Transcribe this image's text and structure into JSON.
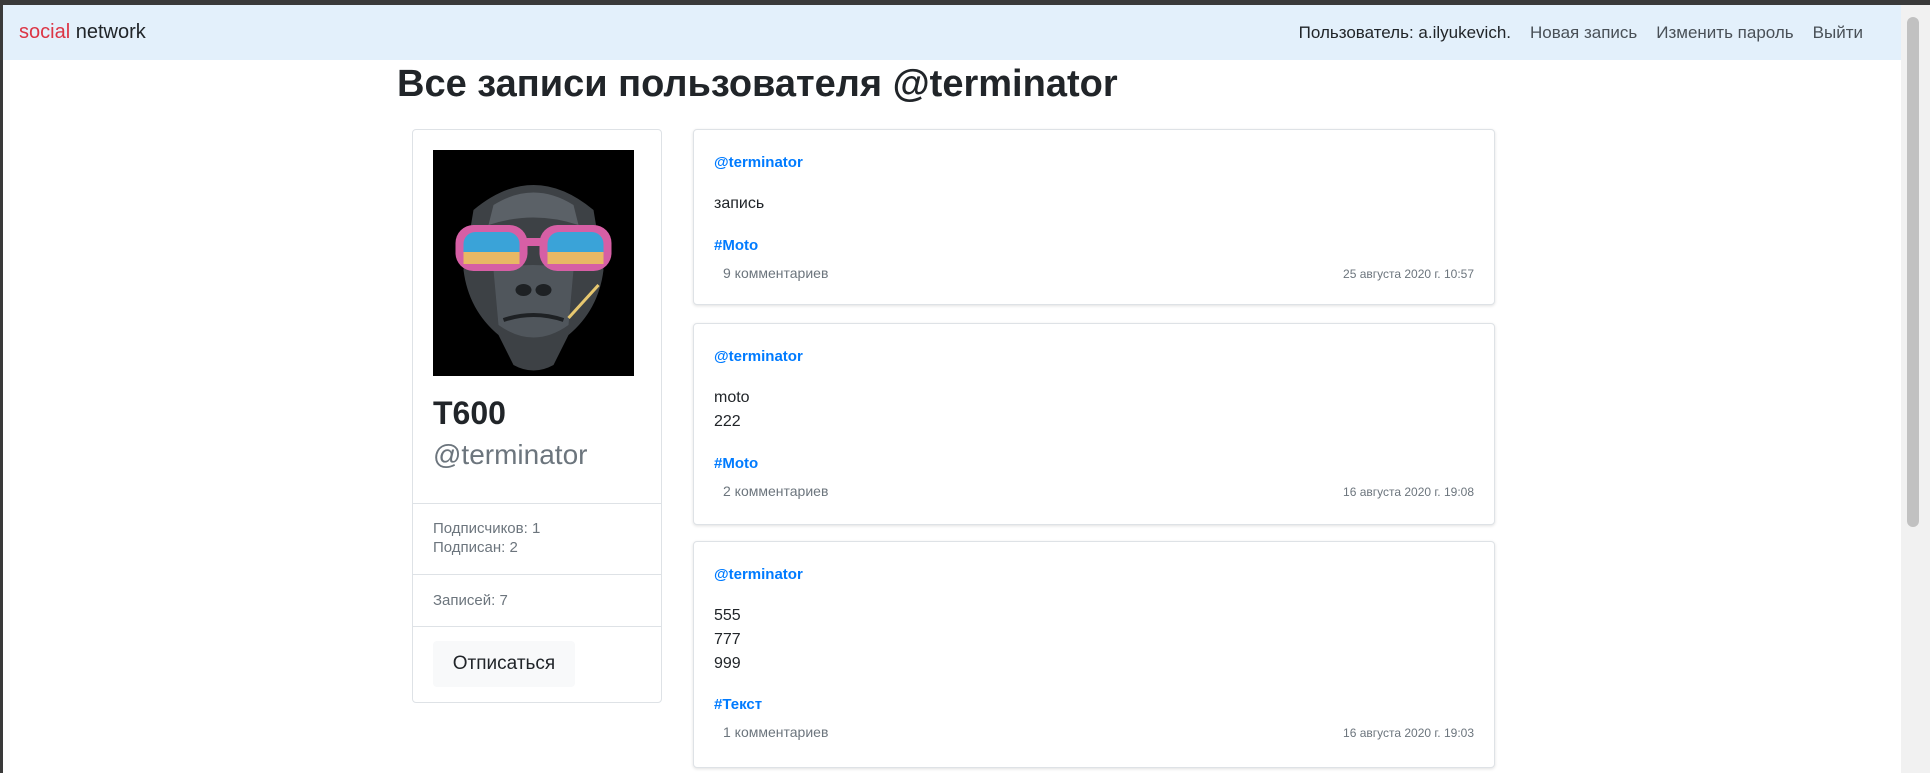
{
  "navbar": {
    "brand_part1": "social",
    "brand_part2": "network",
    "user_label": "Пользователь: a.ilyukevich.",
    "links": [
      "Новая запись",
      "Изменить пароль",
      "Выйти"
    ]
  },
  "page_title": "Все записи пользователя @terminator",
  "profile": {
    "avatar_icon": "gorilla-avatar-icon",
    "name": "T600",
    "handle": "@terminator",
    "followers": "Подписчиков: 1",
    "following": "Подписан: 2",
    "posts_count": "Записей: 7",
    "unsubscribe_label": "Отписаться"
  },
  "posts": [
    {
      "author": "@terminator",
      "lines": [
        "запись"
      ],
      "tag": "#Moto",
      "comments": "9 комментариев",
      "date": "25 августа 2020 г. 10:57"
    },
    {
      "author": "@terminator",
      "lines": [
        "moto",
        "222"
      ],
      "tag": "#Moto",
      "comments": "2 комментариев",
      "date": "16 августа 2020 г. 19:08"
    },
    {
      "author": "@terminator",
      "lines": [
        "555",
        "777",
        "999"
      ],
      "tag": "#Текст",
      "comments": "1 комментариев",
      "date": "16 августа 2020 г. 19:03"
    }
  ],
  "colors": {
    "navbar_bg": "#e3f0fb",
    "brand_accent": "#dc3545",
    "link_blue": "#007bff",
    "muted": "#6c757d"
  }
}
